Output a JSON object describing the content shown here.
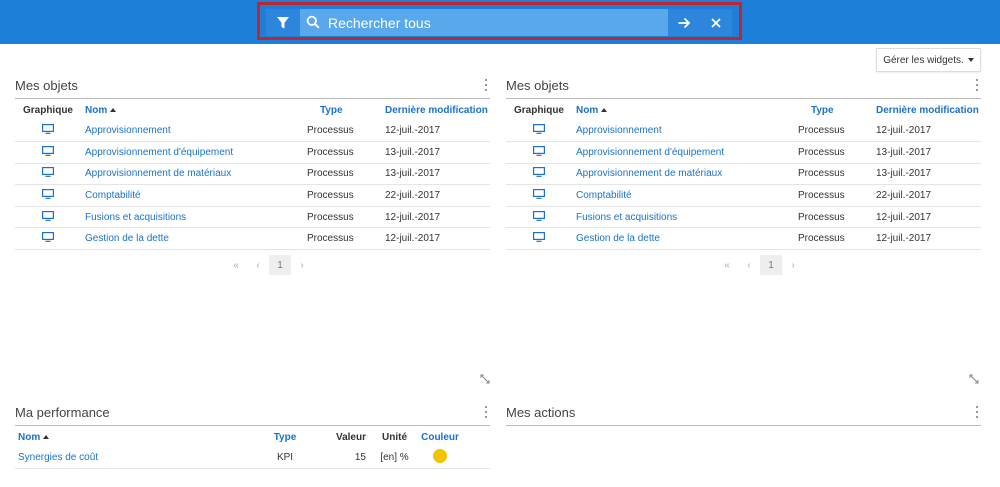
{
  "search": {
    "placeholder": "Rechercher tous"
  },
  "widgets_button": {
    "label": "Gérer les widgets."
  },
  "objects_widget_left": {
    "title": "Mes objets",
    "headers": {
      "graphique": "Graphique",
      "nom": "Nom",
      "type": "Type",
      "modif": "Dernière modification"
    },
    "rows": [
      {
        "name": "Approvisionnement",
        "type": "Processus",
        "date": "12-juil.-2017"
      },
      {
        "name": "Approvisionnement d'équipement",
        "type": "Processus",
        "date": "13-juil.-2017"
      },
      {
        "name": "Approvisionnement de matériaux",
        "type": "Processus",
        "date": "13-juil.-2017"
      },
      {
        "name": "Comptabilité",
        "type": "Processus",
        "date": "22-juil.-2017"
      },
      {
        "name": "Fusions et acquisitions",
        "type": "Processus",
        "date": "12-juil.-2017"
      },
      {
        "name": "Gestion de la dette",
        "type": "Processus",
        "date": "12-juil.-2017"
      }
    ],
    "pager": {
      "first": "«",
      "prev": "‹",
      "page": "1",
      "next": "›"
    }
  },
  "objects_widget_right": {
    "title": "Mes objets",
    "headers": {
      "graphique": "Graphique",
      "nom": "Nom",
      "type": "Type",
      "modif": "Dernière modification"
    },
    "rows": [
      {
        "name": "Approvisionnement",
        "type": "Processus",
        "date": "12-juil.-2017"
      },
      {
        "name": "Approvisionnement d'équipement",
        "type": "Processus",
        "date": "13-juil.-2017"
      },
      {
        "name": "Approvisionnement de matériaux",
        "type": "Processus",
        "date": "13-juil.-2017"
      },
      {
        "name": "Comptabilité",
        "type": "Processus",
        "date": "22-juil.-2017"
      },
      {
        "name": "Fusions et acquisitions",
        "type": "Processus",
        "date": "12-juil.-2017"
      },
      {
        "name": "Gestion de la dette",
        "type": "Processus",
        "date": "12-juil.-2017"
      }
    ],
    "pager": {
      "first": "«",
      "prev": "‹",
      "page": "1",
      "next": "›"
    }
  },
  "performance_widget": {
    "title": "Ma performance",
    "headers": {
      "nom": "Nom",
      "type": "Type",
      "valeur": "Valeur",
      "unite": "Unité",
      "couleur": "Couleur"
    },
    "rows": [
      {
        "name": "Synergies de coût",
        "type": "KPI",
        "value": "15",
        "unit": "[en] %",
        "color": "#f5c400"
      }
    ]
  },
  "actions_widget": {
    "title": "Mes actions"
  },
  "colors": {
    "topbar": "#1e7fd8",
    "highlight_border": "#c0262f",
    "link": "#1a73c8",
    "status_yellow": "#f5c400"
  },
  "icons": {
    "filter": "filter-icon",
    "search": "search-icon",
    "go": "arrow-right-icon",
    "clear": "close-icon",
    "graphic": "monitor-icon",
    "menu": "vertical-dots-icon",
    "resize": "resize-icon"
  }
}
